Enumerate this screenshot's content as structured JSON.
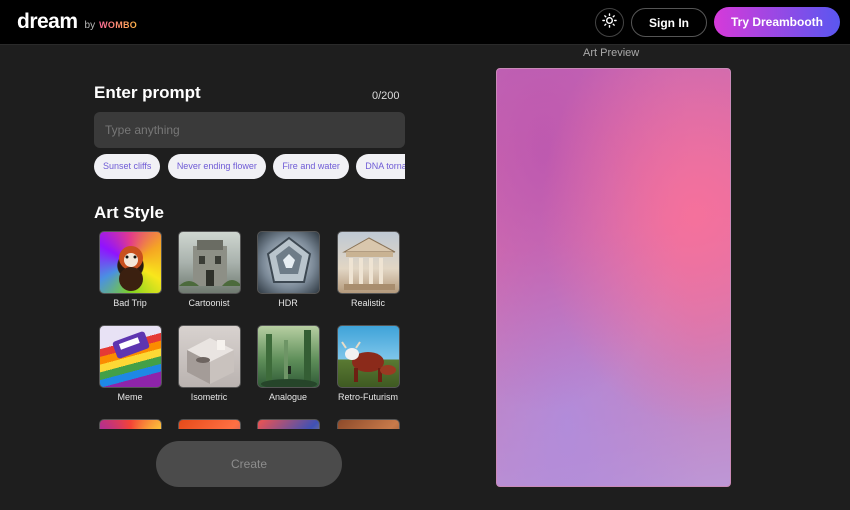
{
  "header": {
    "logo_text": "dream",
    "logo_by": "by",
    "logo_brand": "WOMBO",
    "theme_icon": "sun-icon",
    "sign_in_label": "Sign In",
    "dreambooth_label": "Try Dreambooth"
  },
  "prompt": {
    "title": "Enter prompt",
    "counter": "0/200",
    "placeholder": "Type anything",
    "value": "",
    "suggestions": [
      "Sunset cliffs",
      "Never ending flower",
      "Fire and water",
      "DNA tornado"
    ]
  },
  "art_style": {
    "title": "Art Style",
    "styles": [
      {
        "label": "Bad Trip"
      },
      {
        "label": "Cartoonist"
      },
      {
        "label": "HDR"
      },
      {
        "label": "Realistic"
      },
      {
        "label": "Meme"
      },
      {
        "label": "Isometric"
      },
      {
        "label": "Analogue"
      },
      {
        "label": "Retro-Futurism"
      }
    ]
  },
  "create_label": "Create",
  "preview": {
    "label": "Art Preview"
  },
  "colors": {
    "accent_gradient_start": "#d63ad9",
    "accent_gradient_end": "#5a57f0",
    "chip_text": "#6f5bd6",
    "background": "#1e1e1e"
  }
}
